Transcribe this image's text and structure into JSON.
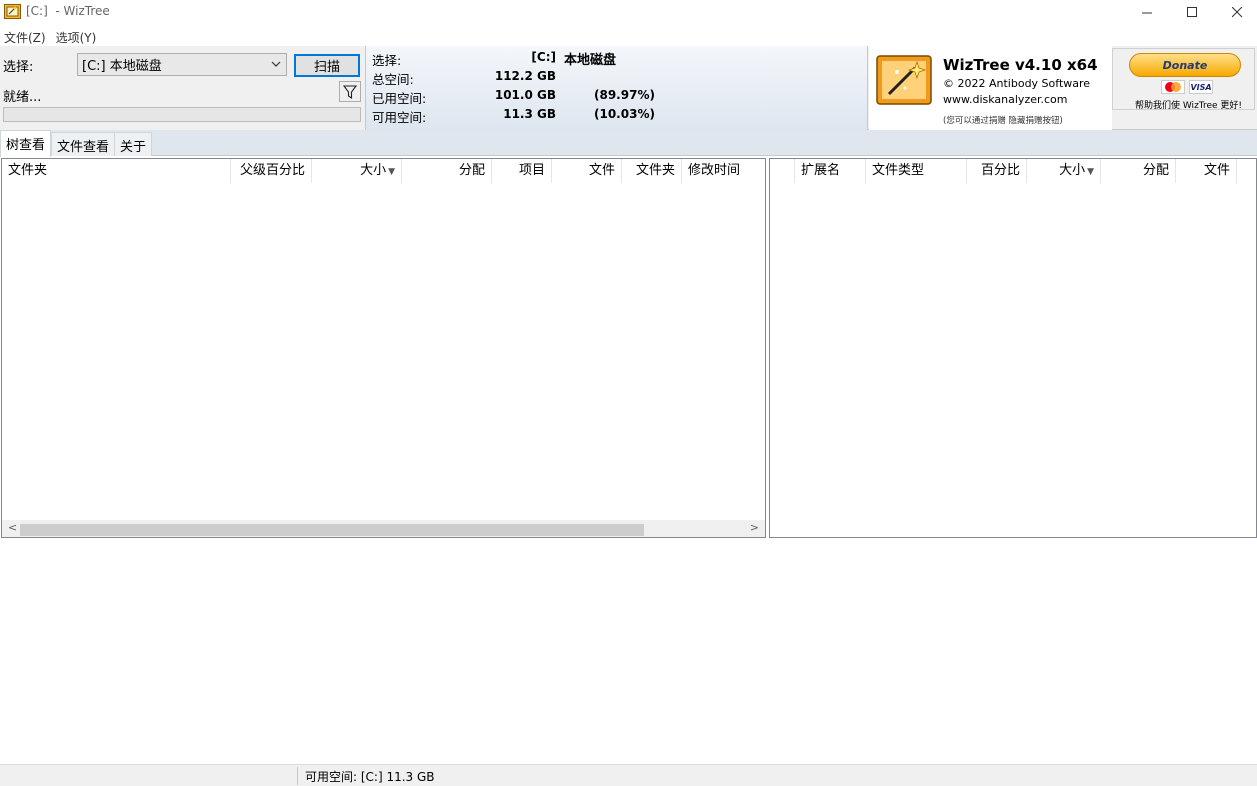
{
  "window": {
    "title": "[C:]  - WizTree",
    "icon": "wiztree-app-icon",
    "controls": {
      "minimize": "—",
      "maximize": "☐",
      "close": "✕"
    }
  },
  "menu": [
    {
      "label": "文件(Z)"
    },
    {
      "label": "选项(Y)"
    }
  ],
  "scan": {
    "select_label": "选择:",
    "drive_value": "[C:] 本地磁盘",
    "scan_button": "扫描",
    "status": "就绪...",
    "filter_icon": "filter-icon",
    "progress": 0
  },
  "disk_info": {
    "select_label": "选择:",
    "drive": "[C:]",
    "drive_name": "本地磁盘",
    "total_label": "总空间:",
    "total_value": "112.2 GB",
    "used_label": "已用空间:",
    "used_value": "101.0 GB",
    "used_percent": "(89.97%)",
    "free_label": "可用空间:",
    "free_value": "11.3 GB",
    "free_percent": "(10.03%)"
  },
  "brand": {
    "title": "WizTree v4.10 x64",
    "copyright": "© 2022 Antibody Software",
    "url": "www.diskanalyzer.com",
    "note": "(您可以通过捐赠 隐藏捐赠按钮)",
    "donate_label": "Donate",
    "donate_note": "帮助我们使 WizTree 更好!",
    "card_visa": "VISA"
  },
  "tabs": [
    {
      "label": "树查看",
      "active": true
    },
    {
      "label": "文件查看",
      "active": false
    },
    {
      "label": "关于",
      "active": false
    }
  ],
  "tree_columns": {
    "folder": "文件夹",
    "parent_pct": "父级百分比",
    "size": "大小",
    "allocated": "分配",
    "items": "项目",
    "files": "文件",
    "folders": "文件夹",
    "modified": "修改时间"
  },
  "ext_columns": {
    "ext": "扩展名",
    "type": "文件类型",
    "pct": "百分比",
    "size": "大小",
    "allocated": "分配",
    "files": "文件"
  },
  "statusbar": {
    "free_space": "可用空间: [C:] 11.3 GB"
  },
  "colors": {
    "accent": "#0078d7",
    "panel_bg": "#f0f0f0",
    "tab_bar": "#dfe6ee",
    "donate_gold": "#f7a800"
  }
}
